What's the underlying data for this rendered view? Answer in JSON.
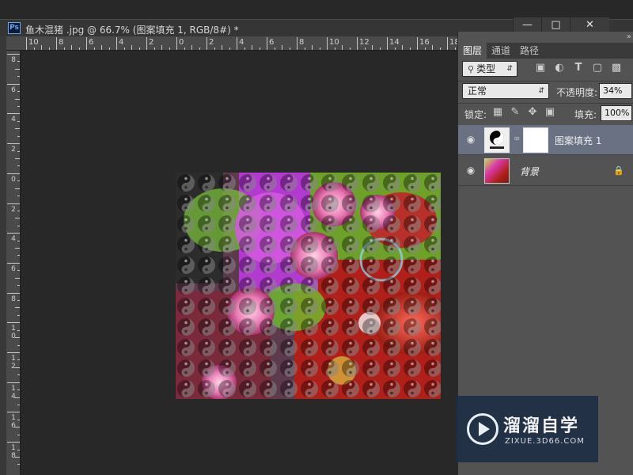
{
  "window": {
    "title": "鱼木混猪 .jpg @ 66.7% (图案填充 1, RGB/8#) *",
    "app_icon": "Ps",
    "minimize_icon": "minimize-icon",
    "maximize_icon": "maximize-icon",
    "close_icon": "close-icon"
  },
  "ruler_top": {
    "labels": [
      "10",
      "8",
      "6",
      "4",
      "2",
      "0",
      "2",
      "4",
      "6",
      "8",
      "10",
      "12",
      "14",
      "16",
      "18"
    ]
  },
  "ruler_left": {
    "labels": [
      "8",
      "6",
      "4",
      "2",
      "0",
      "2",
      "4",
      "6",
      "8",
      "10",
      "12",
      "14",
      "16",
      "18"
    ]
  },
  "layers_panel": {
    "tabs": [
      "图层",
      "通道",
      "路径"
    ],
    "active_tab": "图层",
    "collapse_icon": "double-chevron-icon",
    "filter_select": "类型",
    "filter_icons": [
      "image-filter-icon",
      "adjustment-filter-icon",
      "text-filter-icon",
      "shape-filter-icon",
      "smart-object-filter-icon"
    ],
    "blend_mode": "正常",
    "opacity_label": "不透明度:",
    "opacity_value": "34%",
    "lock_label": "锁定:",
    "lock_icons": [
      "lock-transparent-icon",
      "lock-paint-icon",
      "lock-move-icon",
      "lock-all-icon"
    ],
    "fill_label": "填充:",
    "fill_value": "100%",
    "layers": [
      {
        "name": "图案填充 1",
        "selected": true,
        "visible": true
      },
      {
        "name": "背景",
        "selected": false,
        "visible": true,
        "locked": true
      }
    ]
  },
  "watermark": {
    "title": "溜溜自学",
    "url": "ZIXUE.3D66.COM"
  },
  "colors": {
    "canvas_bg": "#282828",
    "panel_bg": "#535353",
    "selected_layer": "#6a7183",
    "accent_blue": "#6aa6e8"
  }
}
